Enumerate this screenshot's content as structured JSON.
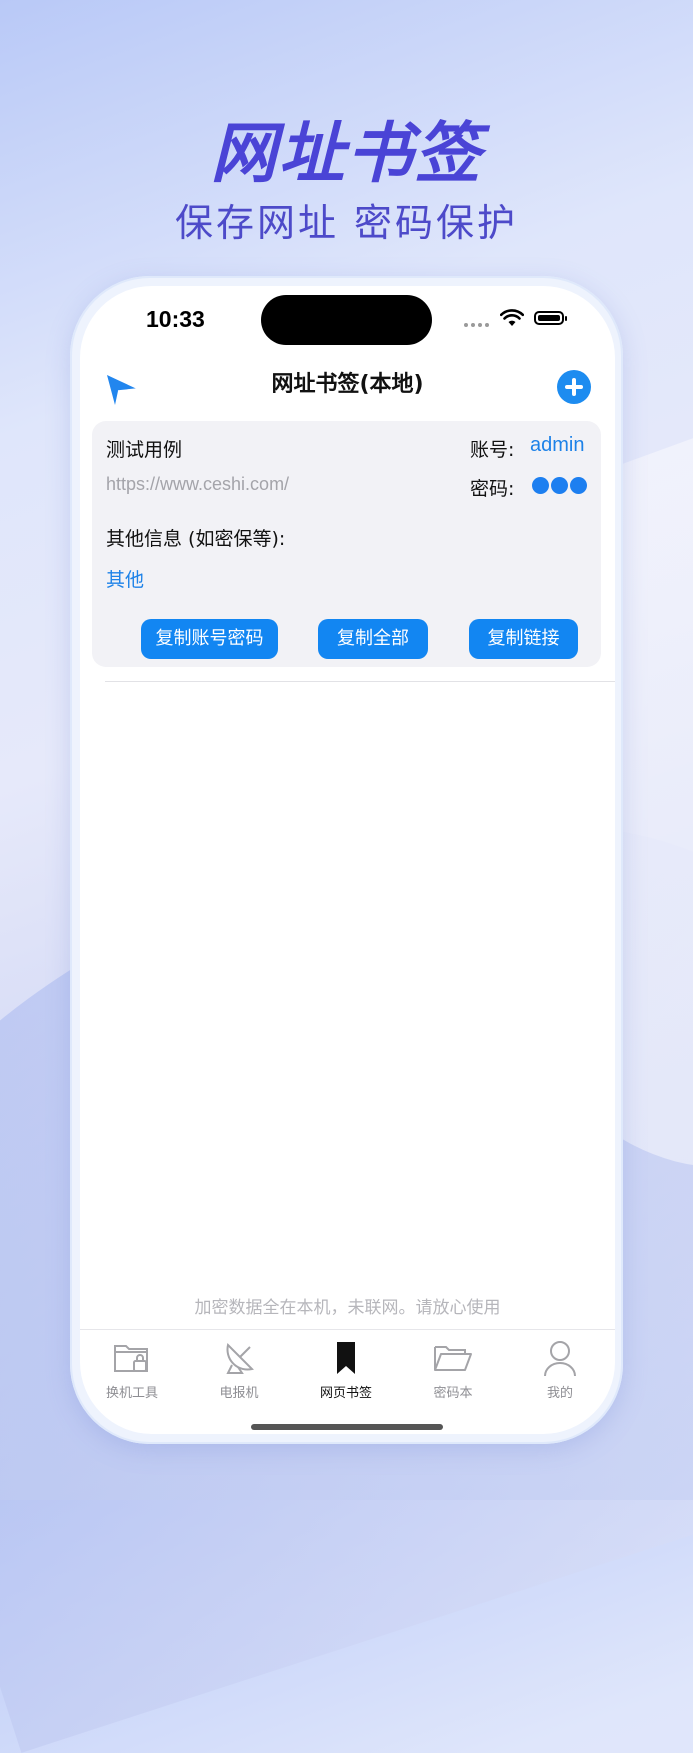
{
  "promo": {
    "title": "网址书签",
    "subtitle": "保存网址 密码保护"
  },
  "status_bar": {
    "time": "10:33"
  },
  "nav": {
    "title": "网址书签(本地)",
    "left_icon": "send-icon",
    "right_icon": "add-circle-icon"
  },
  "entry": {
    "name": "测试用例",
    "url": "https://www.ceshi.com/",
    "account_label": "账号:",
    "account_value": "admin",
    "password_label": "密码:",
    "password_masked_dots": 3,
    "other_label": "其他信息 (如密保等):",
    "other_value": "其他",
    "buttons": {
      "copy_account_password": "复制账号密码",
      "copy_all": "复制全部",
      "copy_link": "复制链接"
    }
  },
  "footer_note": "加密数据全在本机，未联网。请放心使用",
  "tabs": [
    {
      "label": "换机工具",
      "icon": "folder-lock-icon",
      "active": false
    },
    {
      "label": "电报机",
      "icon": "satellite-dish-icon",
      "active": false
    },
    {
      "label": "网页书签",
      "icon": "bookmark-icon",
      "active": true
    },
    {
      "label": "密码本",
      "icon": "folder-open-icon",
      "active": false
    },
    {
      "label": "我的",
      "icon": "person-icon",
      "active": false
    }
  ],
  "colors": {
    "accent": "#1286f2",
    "link": "#1d82e8",
    "promo_text": "#4a44d6"
  }
}
